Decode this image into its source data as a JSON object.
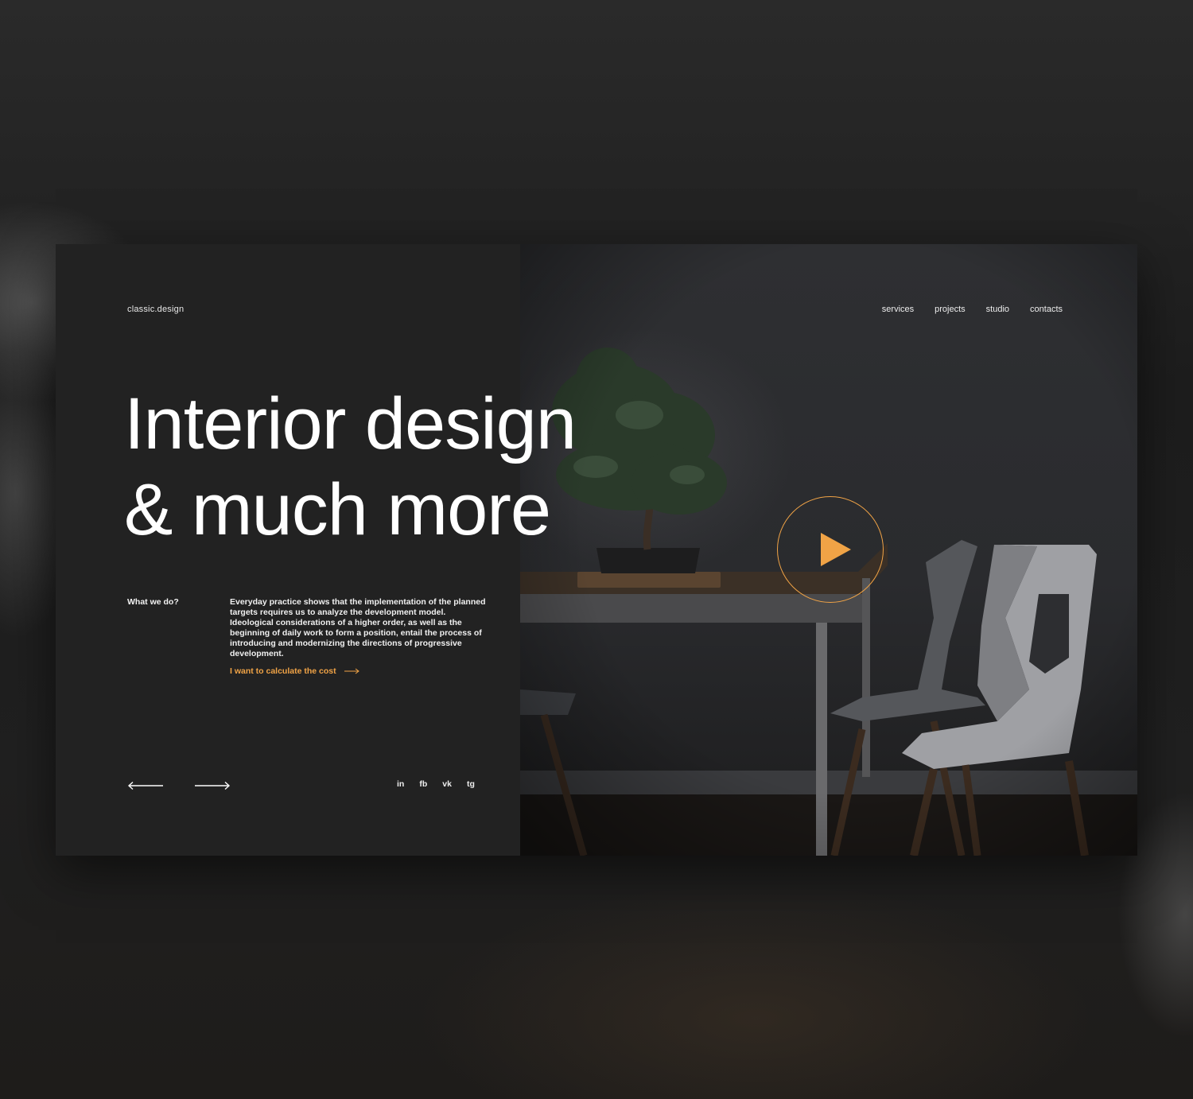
{
  "brand": {
    "logo_text": "classic.design"
  },
  "nav": {
    "items": [
      {
        "label": "services"
      },
      {
        "label": "projects"
      },
      {
        "label": "studio"
      },
      {
        "label": "contacts"
      }
    ]
  },
  "hero": {
    "headline_line1": "Interior design",
    "headline_line2": "& much more"
  },
  "about": {
    "label": "What we do?",
    "description": "Everyday practice shows that the implementation of the planned targets requires us to analyze the development model. Ideological considerations of a higher order, as well as the beginning of daily work to form a position, entail the process of introducing and modernizing the directions of progressive development.",
    "cta_label": "I want to calculate the cost"
  },
  "slider": {
    "prev_icon": "arrow-left-icon",
    "next_icon": "arrow-right-icon"
  },
  "social": {
    "items": [
      {
        "label": "in"
      },
      {
        "label": "fb"
      },
      {
        "label": "vk"
      },
      {
        "label": "tg"
      }
    ]
  },
  "video": {
    "icon": "play-icon"
  },
  "colors": {
    "accent": "#f0a346",
    "panel": "#222222",
    "text": "#ffffff"
  }
}
